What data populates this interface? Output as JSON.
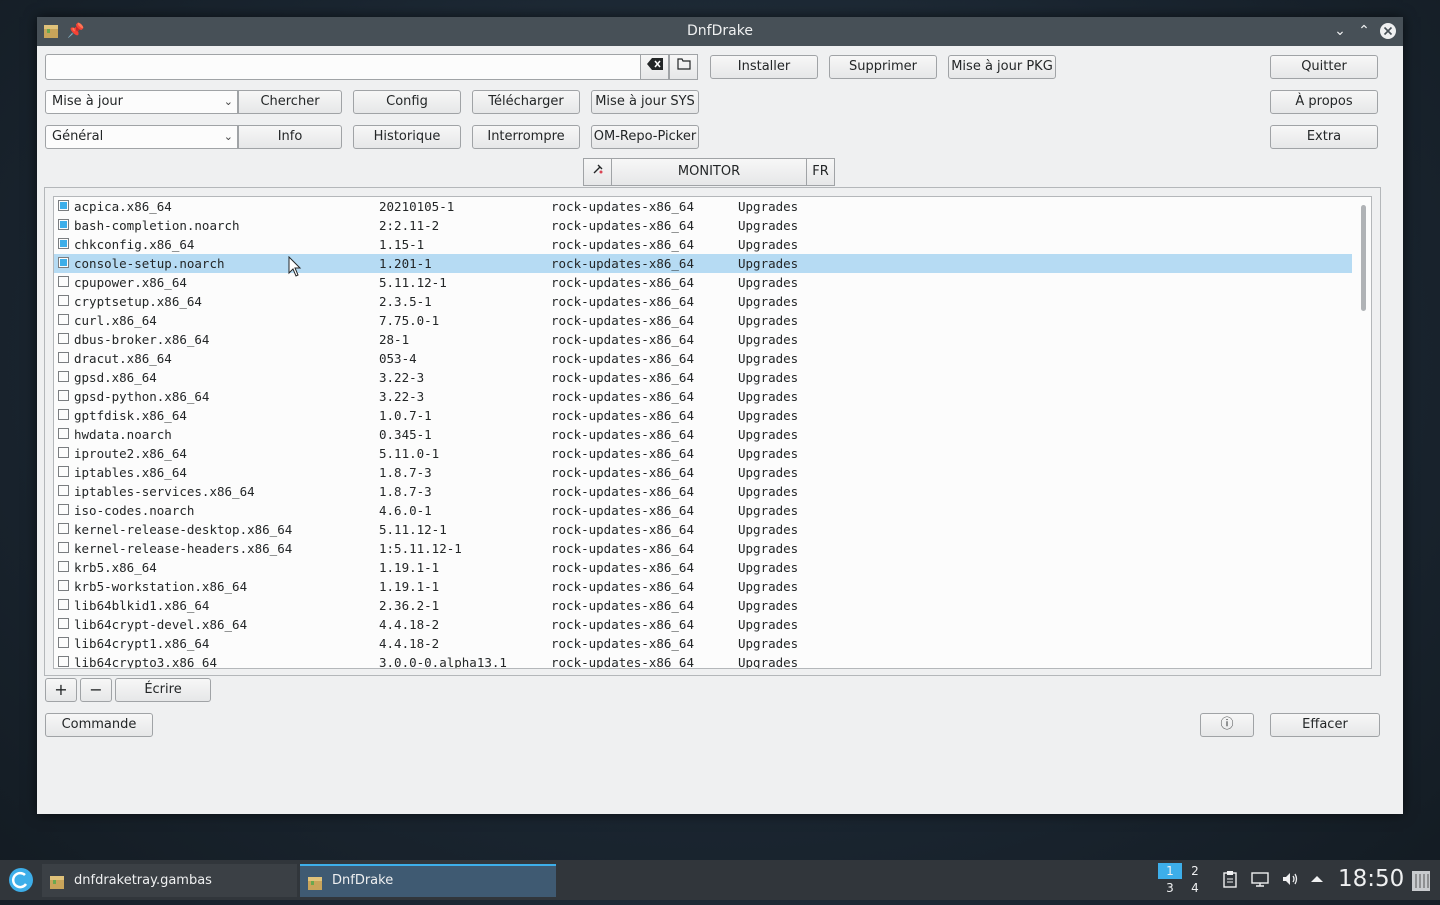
{
  "window": {
    "title": "DnfDrake"
  },
  "toolbar": {
    "install": "Installer",
    "remove": "Supprimer",
    "update_pkg": "Mise à jour PKG",
    "quit": "Quitter",
    "search": "Chercher",
    "config": "Config",
    "download": "Télécharger",
    "update_sys": "Mise à jour SYS",
    "about": "À propos",
    "info": "Info",
    "history": "Historique",
    "interrupt": "Interrompre",
    "repo_picker": "OM-Repo-Picker",
    "extra": "Extra",
    "combo_mode": "Mise à jour",
    "combo_category": "Général",
    "monitor": "MONITOR",
    "lang": "FR"
  },
  "packages": [
    {
      "name": "acpica.x86_64",
      "version": "20210105-1",
      "repo": "rock-updates-x86_64",
      "type": "Upgrades",
      "checked": true
    },
    {
      "name": "bash-completion.noarch",
      "version": "2:2.11-2",
      "repo": "rock-updates-x86_64",
      "type": "Upgrades",
      "checked": true
    },
    {
      "name": "chkconfig.x86_64",
      "version": "1.15-1",
      "repo": "rock-updates-x86_64",
      "type": "Upgrades",
      "checked": true
    },
    {
      "name": "console-setup.noarch",
      "version": "1.201-1",
      "repo": "rock-updates-x86_64",
      "type": "Upgrades",
      "checked": true,
      "selected": true
    },
    {
      "name": "cpupower.x86_64",
      "version": "5.11.12-1",
      "repo": "rock-updates-x86_64",
      "type": "Upgrades",
      "checked": false
    },
    {
      "name": "cryptsetup.x86_64",
      "version": "2.3.5-1",
      "repo": "rock-updates-x86_64",
      "type": "Upgrades",
      "checked": false
    },
    {
      "name": "curl.x86_64",
      "version": "7.75.0-1",
      "repo": "rock-updates-x86_64",
      "type": "Upgrades",
      "checked": false
    },
    {
      "name": "dbus-broker.x86_64",
      "version": "28-1",
      "repo": "rock-updates-x86_64",
      "type": "Upgrades",
      "checked": false
    },
    {
      "name": "dracut.x86_64",
      "version": "053-4",
      "repo": "rock-updates-x86_64",
      "type": "Upgrades",
      "checked": false
    },
    {
      "name": "gpsd.x86_64",
      "version": "3.22-3",
      "repo": "rock-updates-x86_64",
      "type": "Upgrades",
      "checked": false
    },
    {
      "name": "gpsd-python.x86_64",
      "version": "3.22-3",
      "repo": "rock-updates-x86_64",
      "type": "Upgrades",
      "checked": false
    },
    {
      "name": "gptfdisk.x86_64",
      "version": "1.0.7-1",
      "repo": "rock-updates-x86_64",
      "type": "Upgrades",
      "checked": false
    },
    {
      "name": "hwdata.noarch",
      "version": "0.345-1",
      "repo": "rock-updates-x86_64",
      "type": "Upgrades",
      "checked": false
    },
    {
      "name": "iproute2.x86_64",
      "version": "5.11.0-1",
      "repo": "rock-updates-x86_64",
      "type": "Upgrades",
      "checked": false
    },
    {
      "name": "iptables.x86_64",
      "version": "1.8.7-3",
      "repo": "rock-updates-x86_64",
      "type": "Upgrades",
      "checked": false
    },
    {
      "name": "iptables-services.x86_64",
      "version": "1.8.7-3",
      "repo": "rock-updates-x86_64",
      "type": "Upgrades",
      "checked": false
    },
    {
      "name": "iso-codes.noarch",
      "version": "4.6.0-1",
      "repo": "rock-updates-x86_64",
      "type": "Upgrades",
      "checked": false
    },
    {
      "name": "kernel-release-desktop.x86_64",
      "version": "5.11.12-1",
      "repo": "rock-updates-x86_64",
      "type": "Upgrades",
      "checked": false
    },
    {
      "name": "kernel-release-headers.x86_64",
      "version": "1:5.11.12-1",
      "repo": "rock-updates-x86_64",
      "type": "Upgrades",
      "checked": false
    },
    {
      "name": "krb5.x86_64",
      "version": "1.19.1-1",
      "repo": "rock-updates-x86_64",
      "type": "Upgrades",
      "checked": false
    },
    {
      "name": "krb5-workstation.x86_64",
      "version": "1.19.1-1",
      "repo": "rock-updates-x86_64",
      "type": "Upgrades",
      "checked": false
    },
    {
      "name": "lib64blkid1.x86_64",
      "version": "2.36.2-1",
      "repo": "rock-updates-x86_64",
      "type": "Upgrades",
      "checked": false
    },
    {
      "name": "lib64crypt-devel.x86_64",
      "version": "4.4.18-2",
      "repo": "rock-updates-x86_64",
      "type": "Upgrades",
      "checked": false
    },
    {
      "name": "lib64crypt1.x86_64",
      "version": "4.4.18-2",
      "repo": "rock-updates-x86_64",
      "type": "Upgrades",
      "checked": false
    },
    {
      "name": "lib64crypto3.x86_64",
      "version": "3.0.0-0.alpha13.1",
      "repo": "rock-updates-x86_64",
      "type": "Upgrades",
      "checked": false
    }
  ],
  "bottom": {
    "add": "+",
    "remove": "−",
    "write": "Écrire",
    "command": "Commande",
    "info_icon": "ⓘ",
    "clear": "Effacer"
  },
  "taskbar": {
    "task1": "dnfdraketray.gambas",
    "task2": "DnfDrake",
    "pager": [
      "1",
      "2",
      "3",
      "4"
    ],
    "clock": "18:50"
  }
}
